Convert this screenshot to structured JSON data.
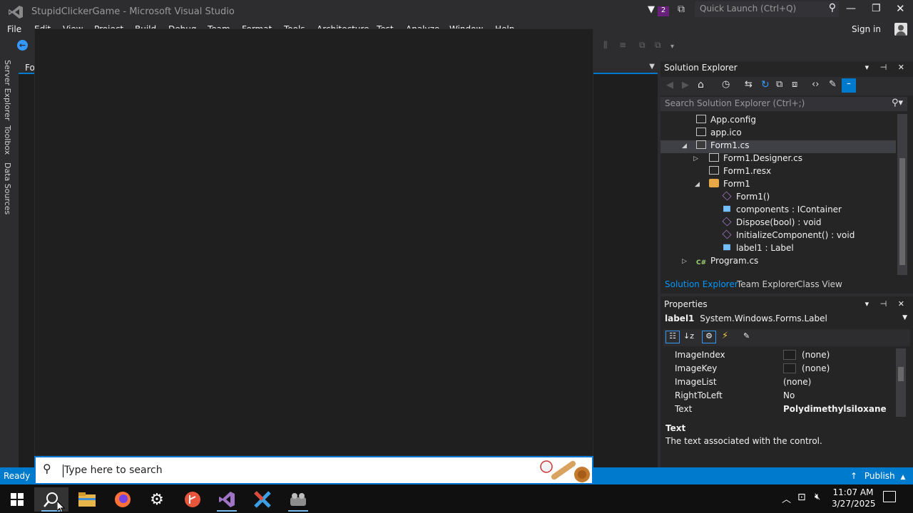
{
  "window": {
    "title": "StupidClickerGame - Microsoft Visual Studio",
    "filter_count": "2",
    "quick_launch_placeholder": "Quick Launch (Ctrl+Q)",
    "sign_in": "Sign in"
  },
  "menu": {
    "items": [
      "File",
      "Edit",
      "View",
      "Project",
      "Build",
      "Debug",
      "Team",
      "Format",
      "Tools",
      "Architecture",
      "Test",
      "Analyze",
      "Window",
      "Help"
    ]
  },
  "left_strip": {
    "tabs": [
      "Server Explorer",
      "Toolbox",
      "Data Sources"
    ]
  },
  "document": {
    "tab_label": "Fo"
  },
  "solution_explorer": {
    "title": "Solution Explorer",
    "search_placeholder": "Search Solution Explorer (Ctrl+;)",
    "tree": [
      {
        "label": "App.config",
        "icon": "config-file-icon",
        "color": "#c5c5c5"
      },
      {
        "label": "app.ico",
        "icon": "icon-file-icon",
        "color": "#c5c5c5"
      },
      {
        "label": "Form1.cs",
        "icon": "form-file-icon",
        "color": "#c5c5c5",
        "selected": true,
        "expanded": true
      },
      {
        "label": "Form1.Designer.cs",
        "icon": "cs-designer-file-icon",
        "color": "#c5c5c5",
        "expandable": true
      },
      {
        "label": "Form1.resx",
        "icon": "resx-file-icon",
        "color": "#c5c5c5"
      },
      {
        "label": "Form1",
        "icon": "class-icon",
        "color": "#e8a845",
        "expanded": true
      },
      {
        "label": "Form1()",
        "icon": "method-icon",
        "color": "#b180d7"
      },
      {
        "label": "components : IContainer",
        "icon": "field-icon",
        "color": "#75beff"
      },
      {
        "label": "Dispose(bool) : void",
        "icon": "method-icon",
        "color": "#b180d7"
      },
      {
        "label": "InitializeComponent() : void",
        "icon": "method-icon",
        "color": "#b180d7"
      },
      {
        "label": "label1 : Label",
        "icon": "field-icon",
        "color": "#75beff"
      },
      {
        "label": "Program.cs",
        "icon": "csharp-file-icon",
        "color": "#9fd36f",
        "expandable": true
      }
    ],
    "tabs": [
      "Solution Explorer",
      "Team Explorer",
      "Class View"
    ]
  },
  "properties": {
    "title": "Properties",
    "object_name": "label1",
    "object_type": "System.Windows.Forms.Label",
    "rows": [
      {
        "name": "ImageIndex",
        "value": "(none)",
        "swatch": true
      },
      {
        "name": "ImageKey",
        "value": "(none)",
        "swatch": true
      },
      {
        "name": "ImageList",
        "value": "(none)"
      },
      {
        "name": "RightToLeft",
        "value": "No"
      },
      {
        "name": "Text",
        "value": "Polydimethylsiloxane",
        "bold": true
      }
    ],
    "desc_title": "Text",
    "desc_text": "The text associated with the control."
  },
  "status": {
    "ready": "Ready",
    "publish": "Publish"
  },
  "search": {
    "placeholder": "Type here to search"
  },
  "taskbar": {
    "time": "11:07 AM",
    "date": "3/27/2025"
  },
  "colors": {
    "accent": "#007acc",
    "panel": "#252526",
    "editor": "#1e1e1e",
    "chrome": "#2d2d30"
  }
}
